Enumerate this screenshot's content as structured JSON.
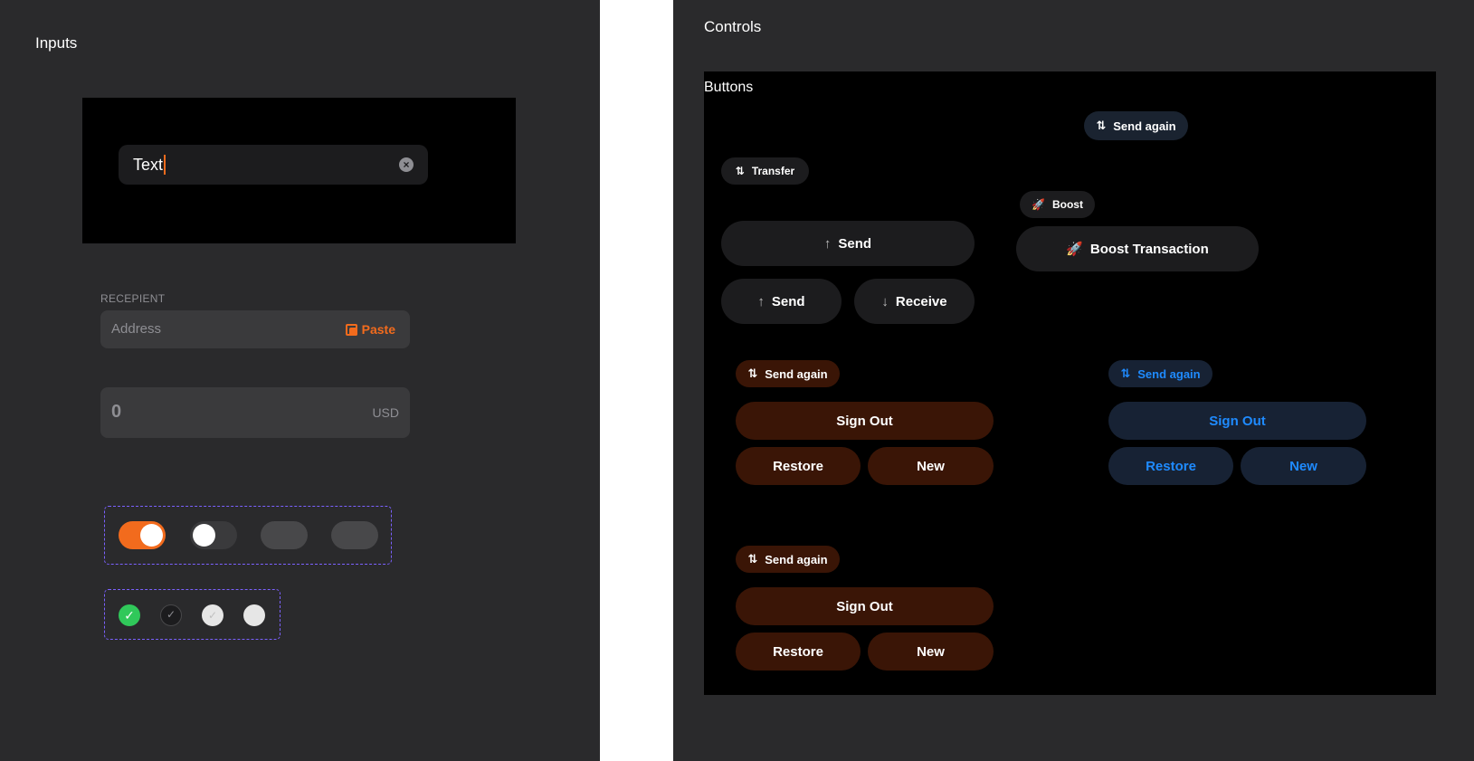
{
  "inputs": {
    "title": "Inputs",
    "text_field": {
      "value": "Text",
      "clear_icon": "clear-circle-icon"
    },
    "recipient": {
      "caption": "RECEPIENT",
      "placeholder": "Address",
      "paste_label": "Paste",
      "paste_icon": "copy-icon"
    },
    "amount": {
      "value": "0",
      "currency": "USD"
    },
    "toggles": [
      {
        "state": "on",
        "color": "#f26b1d"
      },
      {
        "state": "off"
      },
      {
        "state": "disabled"
      },
      {
        "state": "disabled"
      }
    ],
    "checkboxes": [
      {
        "state": "checked",
        "color": "#30c85a"
      },
      {
        "state": "unchecked-dark"
      },
      {
        "state": "checked-light"
      },
      {
        "state": "light"
      }
    ]
  },
  "controls": {
    "title": "Controls",
    "buttons_title": "Buttons",
    "transfer_icon": "arrows-up-down-icon",
    "send_icon": "arrow-up-icon",
    "receive_icon": "arrow-down-icon",
    "rocket_icon": "rocket-icon",
    "send_again_label": "Send again",
    "transfer_label": "Transfer",
    "boost_label": "Boost",
    "boost_transaction_label": "Boost Transaction",
    "send_label": "Send",
    "receive_label": "Receive",
    "sign_out_label": "Sign Out",
    "restore_label": "Restore",
    "new_label": "New",
    "colors": {
      "accent_orange": "#f26b1d",
      "accent_blue": "#1f8bff",
      "brown_bg": "#3a1506",
      "navy_bg": "#172234"
    }
  }
}
